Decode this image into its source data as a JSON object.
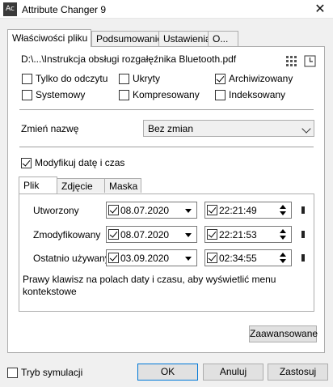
{
  "window": {
    "icon_text": "Ac",
    "title": "Attribute Changer 9",
    "close_glyph": "✕"
  },
  "tabs": [
    "Właściwości pliku",
    "Podsumowanie",
    "Ustawienia",
    "O..."
  ],
  "file": {
    "path": "D:\\...\\Instrukcja obsługi rozgałęźnika Bluetooth.pdf"
  },
  "attributes": [
    {
      "label": "Tylko do odczytu",
      "checked": false
    },
    {
      "label": "Ukryty",
      "checked": false
    },
    {
      "label": "Archiwizowany",
      "checked": true
    },
    {
      "label": "Systemowy",
      "checked": false
    },
    {
      "label": "Kompresowany",
      "checked": false
    },
    {
      "label": "Indeksowany",
      "checked": false
    }
  ],
  "rename": {
    "label": "Zmień nazwę",
    "selected": "Bez zmian"
  },
  "modify_datetime": {
    "label": "Modyfikuj datę i czas",
    "checked": true
  },
  "inner_tabs": [
    "Plik",
    "Zdjęcie",
    "Maska"
  ],
  "dates": [
    {
      "label": "Utworzony",
      "date": "08.07.2020",
      "time": "22:21:49"
    },
    {
      "label": "Zmodyfikowany",
      "date": "08.07.2020",
      "time": "22:21:53"
    },
    {
      "label": "Ostatnio używany",
      "date": "03.09.2020",
      "time": "02:34:55"
    }
  ],
  "hint": "Prawy klawisz na polach daty i czasu, aby wyświetlić menu kontekstowe",
  "buttons": {
    "advanced": "Zaawansowane",
    "simulation": "Tryb symulacji",
    "ok": "OK",
    "cancel": "Anuluj",
    "apply": "Zastosuj"
  },
  "colors": {
    "focus_border": "#0078d7",
    "panel_bg": "#ffffff",
    "window_bg": "#f0f0f0"
  }
}
